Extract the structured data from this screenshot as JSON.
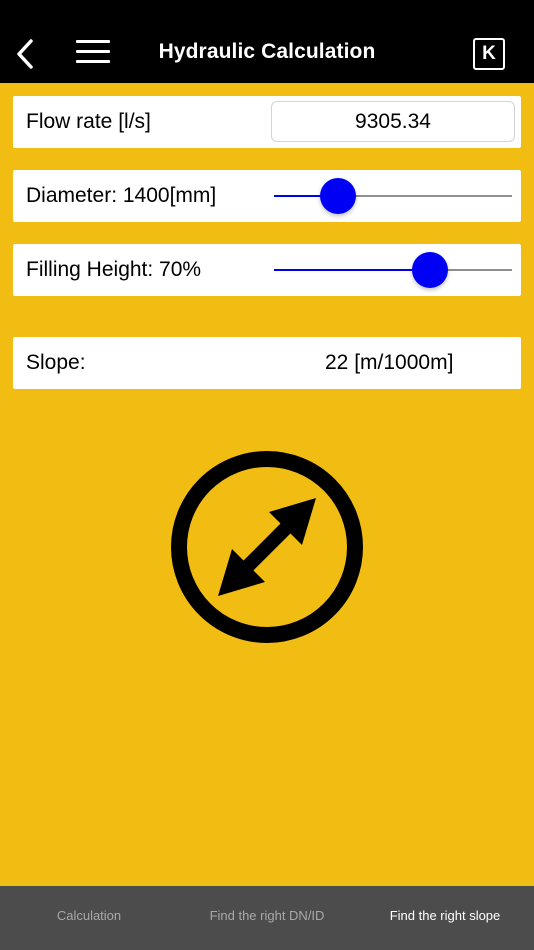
{
  "header": {
    "title": "Hydraulic Calculation",
    "k_label": "K"
  },
  "flow": {
    "label": "Flow rate [l/s]",
    "value": "9305.34"
  },
  "diameter": {
    "label": "Diameter: 1400[mm]",
    "slider_fraction": 0.27
  },
  "filling": {
    "label": "Filling Height: 70%",
    "slider_fraction": 0.655
  },
  "slope": {
    "label": "Slope:",
    "value": "22 [m/1000m]"
  },
  "tabs": [
    {
      "label": "Calculation"
    },
    {
      "label": "Find the right DN/ID"
    },
    {
      "label": "Find the right slope"
    }
  ],
  "active_tab": 2,
  "colors": {
    "background": "#f2bd13",
    "accent": "#0000f5",
    "header": "#000000",
    "tabbar": "#4c4c4c"
  },
  "icons": [
    "chevron-left-icon",
    "hamburger-menu-icon",
    "k-logo-icon",
    "diagonal-double-arrow-icon"
  ]
}
